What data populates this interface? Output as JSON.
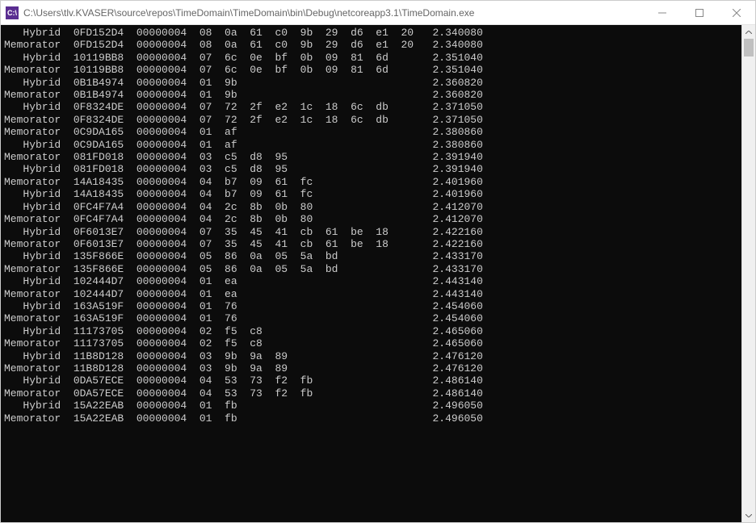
{
  "window": {
    "icon_text": "C:\\",
    "title": "C:\\Users\\tlv.KVASER\\source\\repos\\TimeDomain\\TimeDomain\\bin\\Debug\\netcoreapp3.1\\TimeDomain.exe"
  },
  "console": {
    "rows": [
      {
        "src": "Hybrid",
        "id": "0FD152D4",
        "flags": "00000004",
        "len": "08",
        "bytes": [
          "0a",
          "61",
          "c0",
          "9b",
          "29",
          "d6",
          "e1",
          "20"
        ],
        "time": "2.340080"
      },
      {
        "src": "Memorator",
        "id": "0FD152D4",
        "flags": "00000004",
        "len": "08",
        "bytes": [
          "0a",
          "61",
          "c0",
          "9b",
          "29",
          "d6",
          "e1",
          "20"
        ],
        "time": "2.340080"
      },
      {
        "src": "Hybrid",
        "id": "10119BB8",
        "flags": "00000004",
        "len": "07",
        "bytes": [
          "6c",
          "0e",
          "bf",
          "0b",
          "09",
          "81",
          "6d"
        ],
        "time": "2.351040"
      },
      {
        "src": "Memorator",
        "id": "10119BB8",
        "flags": "00000004",
        "len": "07",
        "bytes": [
          "6c",
          "0e",
          "bf",
          "0b",
          "09",
          "81",
          "6d"
        ],
        "time": "2.351040"
      },
      {
        "src": "Hybrid",
        "id": "0B1B4974",
        "flags": "00000004",
        "len": "01",
        "bytes": [
          "9b"
        ],
        "time": "2.360820"
      },
      {
        "src": "Memorator",
        "id": "0B1B4974",
        "flags": "00000004",
        "len": "01",
        "bytes": [
          "9b"
        ],
        "time": "2.360820"
      },
      {
        "src": "Hybrid",
        "id": "0F8324DE",
        "flags": "00000004",
        "len": "07",
        "bytes": [
          "72",
          "2f",
          "e2",
          "1c",
          "18",
          "6c",
          "db"
        ],
        "time": "2.371050"
      },
      {
        "src": "Memorator",
        "id": "0F8324DE",
        "flags": "00000004",
        "len": "07",
        "bytes": [
          "72",
          "2f",
          "e2",
          "1c",
          "18",
          "6c",
          "db"
        ],
        "time": "2.371050"
      },
      {
        "src": "Memorator",
        "id": "0C9DA165",
        "flags": "00000004",
        "len": "01",
        "bytes": [
          "af"
        ],
        "time": "2.380860"
      },
      {
        "src": "Hybrid",
        "id": "0C9DA165",
        "flags": "00000004",
        "len": "01",
        "bytes": [
          "af"
        ],
        "time": "2.380860"
      },
      {
        "src": "Memorator",
        "id": "081FD018",
        "flags": "00000004",
        "len": "03",
        "bytes": [
          "c5",
          "d8",
          "95"
        ],
        "time": "2.391940"
      },
      {
        "src": "Hybrid",
        "id": "081FD018",
        "flags": "00000004",
        "len": "03",
        "bytes": [
          "c5",
          "d8",
          "95"
        ],
        "time": "2.391940"
      },
      {
        "src": "Memorator",
        "id": "14A18435",
        "flags": "00000004",
        "len": "04",
        "bytes": [
          "b7",
          "09",
          "61",
          "fc"
        ],
        "time": "2.401960"
      },
      {
        "src": "Hybrid",
        "id": "14A18435",
        "flags": "00000004",
        "len": "04",
        "bytes": [
          "b7",
          "09",
          "61",
          "fc"
        ],
        "time": "2.401960"
      },
      {
        "src": "Hybrid",
        "id": "0FC4F7A4",
        "flags": "00000004",
        "len": "04",
        "bytes": [
          "2c",
          "8b",
          "0b",
          "80"
        ],
        "time": "2.412070"
      },
      {
        "src": "Memorator",
        "id": "0FC4F7A4",
        "flags": "00000004",
        "len": "04",
        "bytes": [
          "2c",
          "8b",
          "0b",
          "80"
        ],
        "time": "2.412070"
      },
      {
        "src": "Hybrid",
        "id": "0F6013E7",
        "flags": "00000004",
        "len": "07",
        "bytes": [
          "35",
          "45",
          "41",
          "cb",
          "61",
          "be",
          "18"
        ],
        "time": "2.422160"
      },
      {
        "src": "Memorator",
        "id": "0F6013E7",
        "flags": "00000004",
        "len": "07",
        "bytes": [
          "35",
          "45",
          "41",
          "cb",
          "61",
          "be",
          "18"
        ],
        "time": "2.422160"
      },
      {
        "src": "Hybrid",
        "id": "135F866E",
        "flags": "00000004",
        "len": "05",
        "bytes": [
          "86",
          "0a",
          "05",
          "5a",
          "bd"
        ],
        "time": "2.433170"
      },
      {
        "src": "Memorator",
        "id": "135F866E",
        "flags": "00000004",
        "len": "05",
        "bytes": [
          "86",
          "0a",
          "05",
          "5a",
          "bd"
        ],
        "time": "2.433170"
      },
      {
        "src": "Hybrid",
        "id": "102444D7",
        "flags": "00000004",
        "len": "01",
        "bytes": [
          "ea"
        ],
        "time": "2.443140"
      },
      {
        "src": "Memorator",
        "id": "102444D7",
        "flags": "00000004",
        "len": "01",
        "bytes": [
          "ea"
        ],
        "time": "2.443140"
      },
      {
        "src": "Hybrid",
        "id": "163A519F",
        "flags": "00000004",
        "len": "01",
        "bytes": [
          "76"
        ],
        "time": "2.454060"
      },
      {
        "src": "Memorator",
        "id": "163A519F",
        "flags": "00000004",
        "len": "01",
        "bytes": [
          "76"
        ],
        "time": "2.454060"
      },
      {
        "src": "Hybrid",
        "id": "11173705",
        "flags": "00000004",
        "len": "02",
        "bytes": [
          "f5",
          "c8"
        ],
        "time": "2.465060"
      },
      {
        "src": "Memorator",
        "id": "11173705",
        "flags": "00000004",
        "len": "02",
        "bytes": [
          "f5",
          "c8"
        ],
        "time": "2.465060"
      },
      {
        "src": "Hybrid",
        "id": "11B8D128",
        "flags": "00000004",
        "len": "03",
        "bytes": [
          "9b",
          "9a",
          "89"
        ],
        "time": "2.476120"
      },
      {
        "src": "Memorator",
        "id": "11B8D128",
        "flags": "00000004",
        "len": "03",
        "bytes": [
          "9b",
          "9a",
          "89"
        ],
        "time": "2.476120"
      },
      {
        "src": "Hybrid",
        "id": "0DA57ECE",
        "flags": "00000004",
        "len": "04",
        "bytes": [
          "53",
          "73",
          "f2",
          "fb"
        ],
        "time": "2.486140"
      },
      {
        "src": "Memorator",
        "id": "0DA57ECE",
        "flags": "00000004",
        "len": "04",
        "bytes": [
          "53",
          "73",
          "f2",
          "fb"
        ],
        "time": "2.486140"
      },
      {
        "src": "Hybrid",
        "id": "15A22EAB",
        "flags": "00000004",
        "len": "01",
        "bytes": [
          "fb"
        ],
        "time": "2.496050"
      },
      {
        "src": "Memorator",
        "id": "15A22EAB",
        "flags": "00000004",
        "len": "01",
        "bytes": [
          "fb"
        ],
        "time": "2.496050"
      }
    ]
  }
}
